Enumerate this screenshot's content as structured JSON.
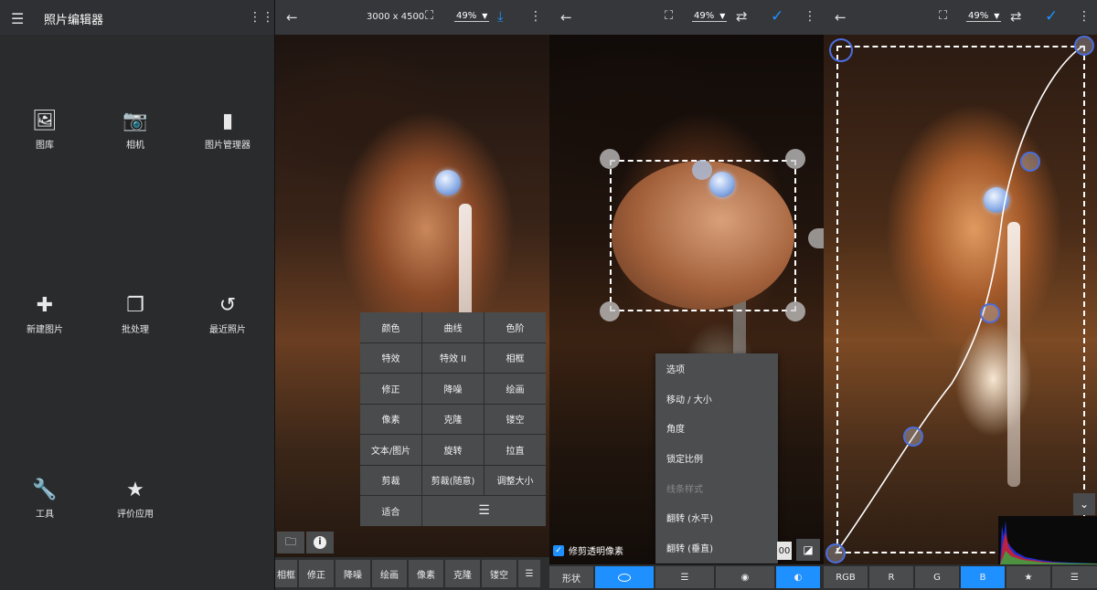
{
  "home": {
    "title": "照片编辑器",
    "items": [
      {
        "label": "图库",
        "icon": "gallery-icon"
      },
      {
        "label": "相机",
        "icon": "camera-icon"
      },
      {
        "label": "图片管理器",
        "icon": "sd-card-icon"
      },
      {
        "label": "新建图片",
        "icon": "new-file-icon"
      },
      {
        "label": "批处理",
        "icon": "batch-icon"
      },
      {
        "label": "最近照片",
        "icon": "history-icon"
      },
      {
        "label": "工具",
        "icon": "wrench-icon"
      },
      {
        "label": "评价应用",
        "icon": "star-icon"
      }
    ]
  },
  "editor": {
    "dimensions": "3000 x 4500",
    "zoom": "49%",
    "menu": [
      "颜色",
      "曲线",
      "色阶",
      "特效",
      "特效 II",
      "相框",
      "修正",
      "降噪",
      "绘画",
      "像素",
      "克隆",
      "镂空",
      "文本/图片",
      "旋转",
      "拉直",
      "剪裁",
      "剪裁(随意)",
      "调整大小",
      "适合"
    ],
    "bottom_tools": [
      "相框",
      "修正",
      "降噪",
      "绘画",
      "像素",
      "克隆",
      "镂空"
    ]
  },
  "crop": {
    "zoom": "49%",
    "checkbox_label": "修剪透明像素",
    "partial_value": "00",
    "context_menu": [
      "选项",
      "移动 / 大小",
      "角度",
      "锁定比例",
      "线条样式",
      "翻转 (水平)",
      "翻转 (垂直)"
    ],
    "disabled_item": "线条样式",
    "tab_shape": "形状"
  },
  "curves": {
    "zoom": "49%",
    "tabs": [
      "RGB",
      "R",
      "G",
      "B"
    ],
    "active_tab": "B"
  },
  "colors": {
    "accent": "#1e90ff",
    "topbar": "#35373a",
    "menu_bg": "#4a4b4d",
    "curve_handle": "#4a6ee0"
  }
}
